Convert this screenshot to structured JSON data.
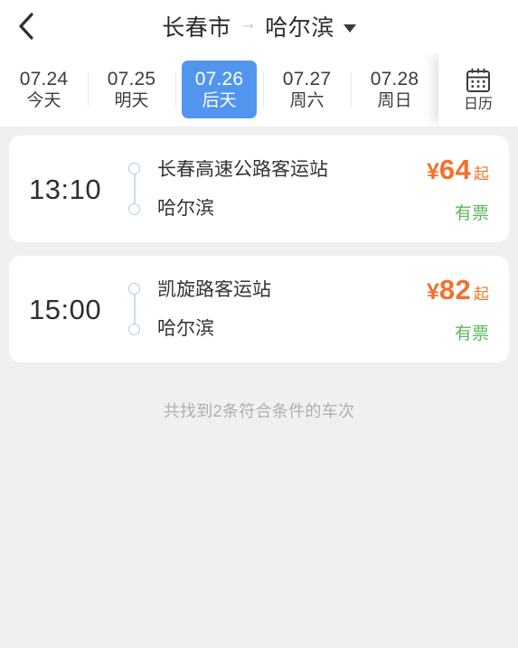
{
  "header": {
    "back_icon": "chevron-left-icon",
    "origin": "长春市",
    "arrow": "→",
    "destination": "哈尔滨",
    "caret_icon": "caret-down-icon"
  },
  "date_strip": {
    "tabs": [
      {
        "date": "07.24",
        "label": "今天",
        "selected": false
      },
      {
        "date": "07.25",
        "label": "明天",
        "selected": false
      },
      {
        "date": "07.26",
        "label": "后天",
        "selected": true
      },
      {
        "date": "07.27",
        "label": "周六",
        "selected": false
      },
      {
        "date": "07.28",
        "label": "周日",
        "selected": false
      }
    ],
    "calendar_button": {
      "icon": "calendar-icon",
      "label": "日历"
    }
  },
  "results": {
    "items": [
      {
        "time": "13:10",
        "from_station": "长春高速公路客运站",
        "to_station": "哈尔滨",
        "price_symbol": "¥",
        "price": "64",
        "price_suffix": "起",
        "ticket_status": "有票"
      },
      {
        "time": "15:00",
        "from_station": "凯旋路客运站",
        "to_station": "哈尔滨",
        "price_symbol": "¥",
        "price": "82",
        "price_suffix": "起",
        "ticket_status": "有票"
      }
    ],
    "footer": "共找到2条符合条件的车次"
  },
  "colors": {
    "accent_blue": "#5195EF",
    "price_orange": "#F2712C",
    "status_green": "#5BB85B",
    "page_bg": "#F0F0F3",
    "card_bg": "#FFFFFF",
    "timeline_blue": "#A8CDEC"
  }
}
